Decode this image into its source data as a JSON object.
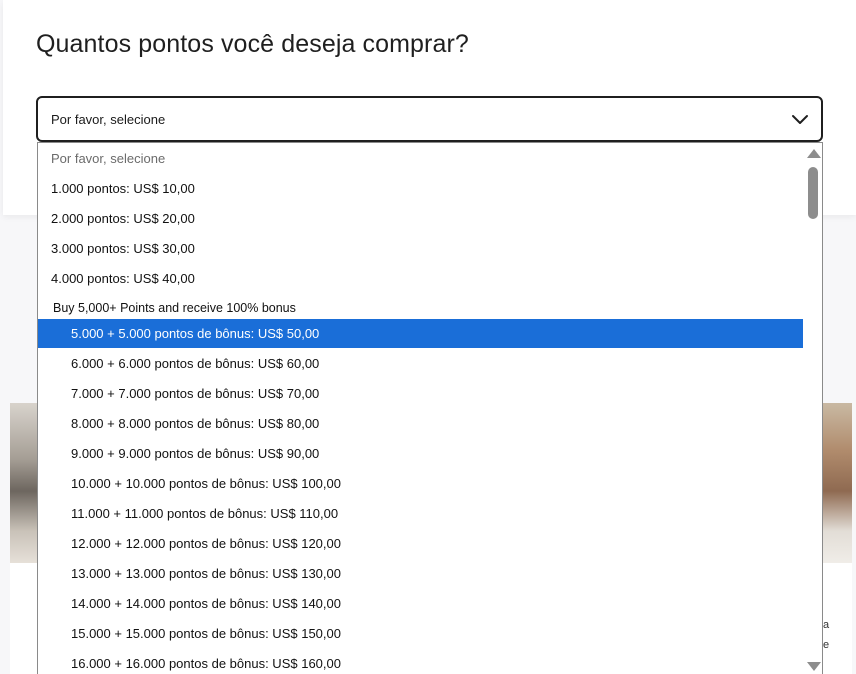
{
  "question": "Quantos pontos você deseja comprar?",
  "select": {
    "value": "Por favor, selecione"
  },
  "dropdown": {
    "placeholder": "Por favor, selecione",
    "plain_options": [
      "1.000 pontos: US$ 10,00",
      "2.000 pontos: US$ 20,00",
      "3.000 pontos: US$ 30,00",
      "4.000 pontos: US$ 40,00"
    ],
    "group_label": "Buy 5,000+ Points and receive 100% bonus",
    "bonus_options": [
      "5.000 + 5.000 pontos de bônus: US$ 50,00",
      "6.000 + 6.000 pontos de bônus: US$ 60,00",
      "7.000 + 7.000 pontos de bônus: US$ 70,00",
      "8.000 + 8.000 pontos de bônus: US$ 80,00",
      "9.000 + 9.000 pontos de bônus: US$ 90,00",
      "10.000 + 10.000 pontos de bônus: US$ 100,00",
      "11.000 + 11.000 pontos de bônus: US$ 110,00",
      "12.000 + 12.000 pontos de bônus: US$ 120,00",
      "13.000 + 13.000 pontos de bônus: US$ 130,00",
      "14.000 + 14.000 pontos de bônus: US$ 140,00",
      "15.000 + 15.000 pontos de bônus: US$ 150,00",
      "16.000 + 16.000 pontos de bônus: US$ 160,00"
    ],
    "selected_option": "5.000 + 5.000 pontos de bônus: US$ 50,00"
  },
  "background": {
    "right_text": "a e"
  },
  "colors": {
    "selected_bg": "#1a6ed8",
    "border": "#1f1f1f"
  },
  "icons": {
    "select_chevron": "chevron-down-icon",
    "scroll_up": "scroll-up-arrow-icon",
    "scroll_down": "scroll-down-arrow-icon"
  }
}
